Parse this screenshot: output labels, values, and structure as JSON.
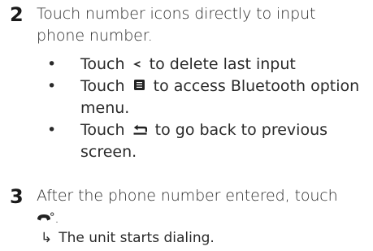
{
  "steps": [
    {
      "number": "2",
      "text_line1": "Touch number icons directly to input",
      "text_line2": "phone number.",
      "bullets": [
        {
          "before": "Touch",
          "icon": "backspace-icon",
          "after": "to delete last input"
        },
        {
          "before": "Touch",
          "icon": "menu-icon",
          "after": "to access Bluetooth option",
          "cont": "menu."
        },
        {
          "before": "Touch",
          "icon": "back-icon",
          "after": "to go back to previous",
          "cont": "screen."
        }
      ]
    },
    {
      "number": "3",
      "text_line1": "After the phone number entered, touch",
      "icon": "phone-call-icon",
      "trail": ".",
      "result_arrow": "↳",
      "result_text": "The unit starts dialing."
    }
  ],
  "bullet_symbol": "•"
}
